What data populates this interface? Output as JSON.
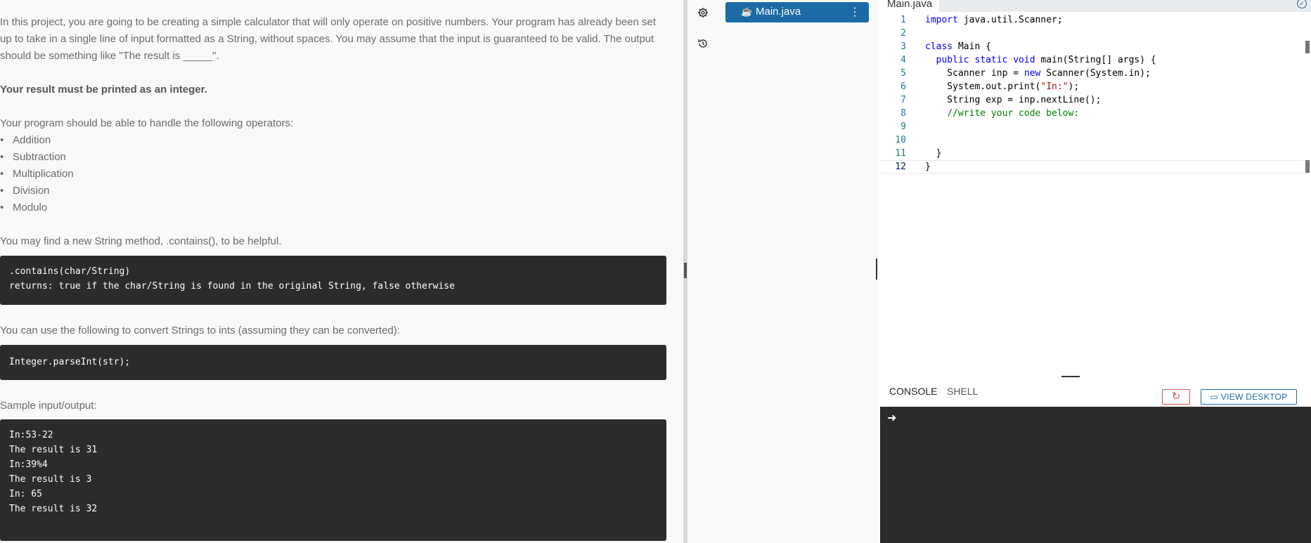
{
  "instructions": {
    "intro": "In this project, you are going to be creating a simple calculator that will only operate on positive numbers. Your program has already been set up to take in a single line of input formatted as a String, without spaces. You may assume that the input is guaranteed to be valid. The output should be something like \"The result is _____\".",
    "integer_note": "Your result must be printed as an integer.",
    "operators_intro": "Your program should be able to handle the following operators:",
    "operators": [
      "Addition",
      "Subtraction",
      "Multiplication",
      "Division",
      "Modulo"
    ],
    "contains_intro": "You may find a new String method, .contains(), to be helpful.",
    "contains_code": [
      ".contains(char/String)",
      "returns: true if the char/String is found in the original String, false otherwise"
    ],
    "convert_intro": "You can use the following to convert Strings to ints (assuming they can be converted):",
    "convert_code": [
      "Integer.parseInt(str);"
    ],
    "sample_intro": "Sample input/output:",
    "sample_code": [
      "In:53-22",
      "The result is 31",
      "In:39%4",
      "The result is 3",
      "In: 65",
      "The result is 32"
    ]
  },
  "sidebar": {
    "settings_icon": "gear-icon",
    "history_icon": "history-icon",
    "file": {
      "name": "Main.java",
      "icon": "java-icon",
      "menu_icon": "kebab-icon"
    }
  },
  "editor": {
    "tab_label": "Main.java",
    "lines": [
      {
        "n": "1",
        "segments": [
          {
            "t": "import",
            "c": "kw"
          },
          {
            "t": " java.util.Scanner;",
            "c": ""
          }
        ]
      },
      {
        "n": "2",
        "segments": []
      },
      {
        "n": "3",
        "segments": [
          {
            "t": "class",
            "c": "kw"
          },
          {
            "t": " Main {",
            "c": ""
          }
        ]
      },
      {
        "n": "4",
        "segments": [
          {
            "t": "  ",
            "c": ""
          },
          {
            "t": "public static void",
            "c": "kw"
          },
          {
            "t": " main(String[] args) {",
            "c": ""
          }
        ]
      },
      {
        "n": "5",
        "segments": [
          {
            "t": "    Scanner inp = ",
            "c": ""
          },
          {
            "t": "new",
            "c": "kw"
          },
          {
            "t": " Scanner(System.in);",
            "c": ""
          }
        ]
      },
      {
        "n": "6",
        "segments": [
          {
            "t": "    System.out.print(",
            "c": ""
          },
          {
            "t": "\"In:\"",
            "c": "str"
          },
          {
            "t": ");",
            "c": ""
          }
        ]
      },
      {
        "n": "7",
        "segments": [
          {
            "t": "    String exp = inp.nextLine();",
            "c": ""
          }
        ]
      },
      {
        "n": "8",
        "segments": [
          {
            "t": "    ",
            "c": ""
          },
          {
            "t": "//write your code below:",
            "c": "cm"
          }
        ]
      },
      {
        "n": "9",
        "segments": []
      },
      {
        "n": "10",
        "segments": []
      },
      {
        "n": "11",
        "segments": [
          {
            "t": "  }",
            "c": ""
          }
        ]
      },
      {
        "n": "12",
        "segments": [
          {
            "t": "}",
            "c": ""
          }
        ],
        "current": true
      }
    ]
  },
  "console": {
    "tabs": [
      "CONSOLE",
      "SHELL"
    ],
    "active_tab": "CONSOLE",
    "restart_icon": "restart-icon",
    "view_desktop_label": "VIEW DESKTOP",
    "prompt": "➜"
  }
}
